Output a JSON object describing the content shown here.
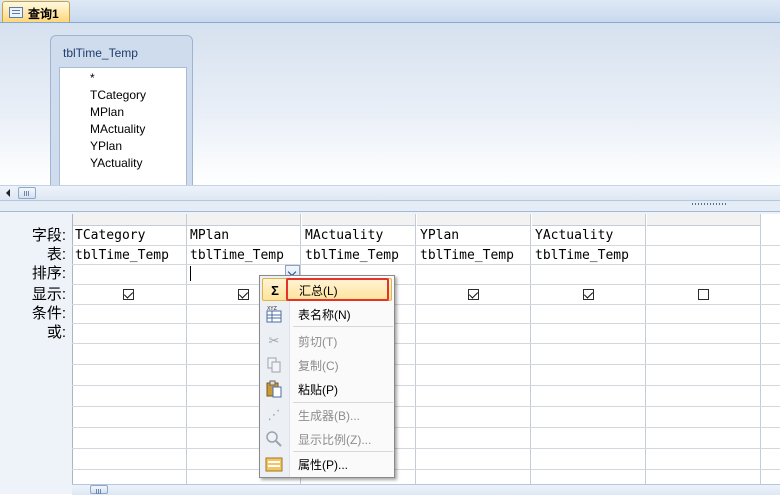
{
  "tab": {
    "label": "查询1",
    "icon": "query-icon"
  },
  "table_box": {
    "title": "tblTime_Temp",
    "fields": [
      "*",
      "TCategory",
      "MPlan",
      "MActuality",
      "YPlan",
      "YActuality"
    ]
  },
  "row_labels": {
    "field": "字段:",
    "table": "表:",
    "sort": "排序:",
    "show": "显示:",
    "criteria": "条件:",
    "or": "或:"
  },
  "columns": [
    {
      "field": "TCategory",
      "table": "tblTime_Temp",
      "show": true
    },
    {
      "field": "MPlan",
      "table": "tblTime_Temp",
      "show": true
    },
    {
      "field": "MActuality",
      "table": "tblTime_Temp",
      "show": true
    },
    {
      "field": "YPlan",
      "table": "tblTime_Temp",
      "show": true
    },
    {
      "field": "YActuality",
      "table": "tblTime_Temp",
      "show": true
    },
    {
      "field": "",
      "table": "",
      "show": false
    }
  ],
  "context_menu": {
    "items": [
      {
        "label": "汇总(L)",
        "icon": "sigma-icon",
        "enabled": true,
        "highlighted": true
      },
      {
        "label": "表名称(N)",
        "icon": "table-names-icon",
        "enabled": true
      },
      {
        "label": "剪切(T)",
        "icon": "scissors-icon",
        "enabled": false
      },
      {
        "label": "复制(C)",
        "icon": "copy-icon",
        "enabled": false
      },
      {
        "label": "粘贴(P)",
        "icon": "paste-icon",
        "enabled": true
      },
      {
        "label": "生成器(B)...",
        "icon": "builder-wand-icon",
        "enabled": false
      },
      {
        "label": "显示比例(Z)...",
        "icon": "zoom-icon",
        "enabled": false
      },
      {
        "label": "属性(P)...",
        "icon": "properties-icon",
        "enabled": true
      }
    ]
  },
  "colors": {
    "highlight_border": "#e53329",
    "menu_hover": "#ffe39b",
    "tab_active": "#ffd77a"
  }
}
